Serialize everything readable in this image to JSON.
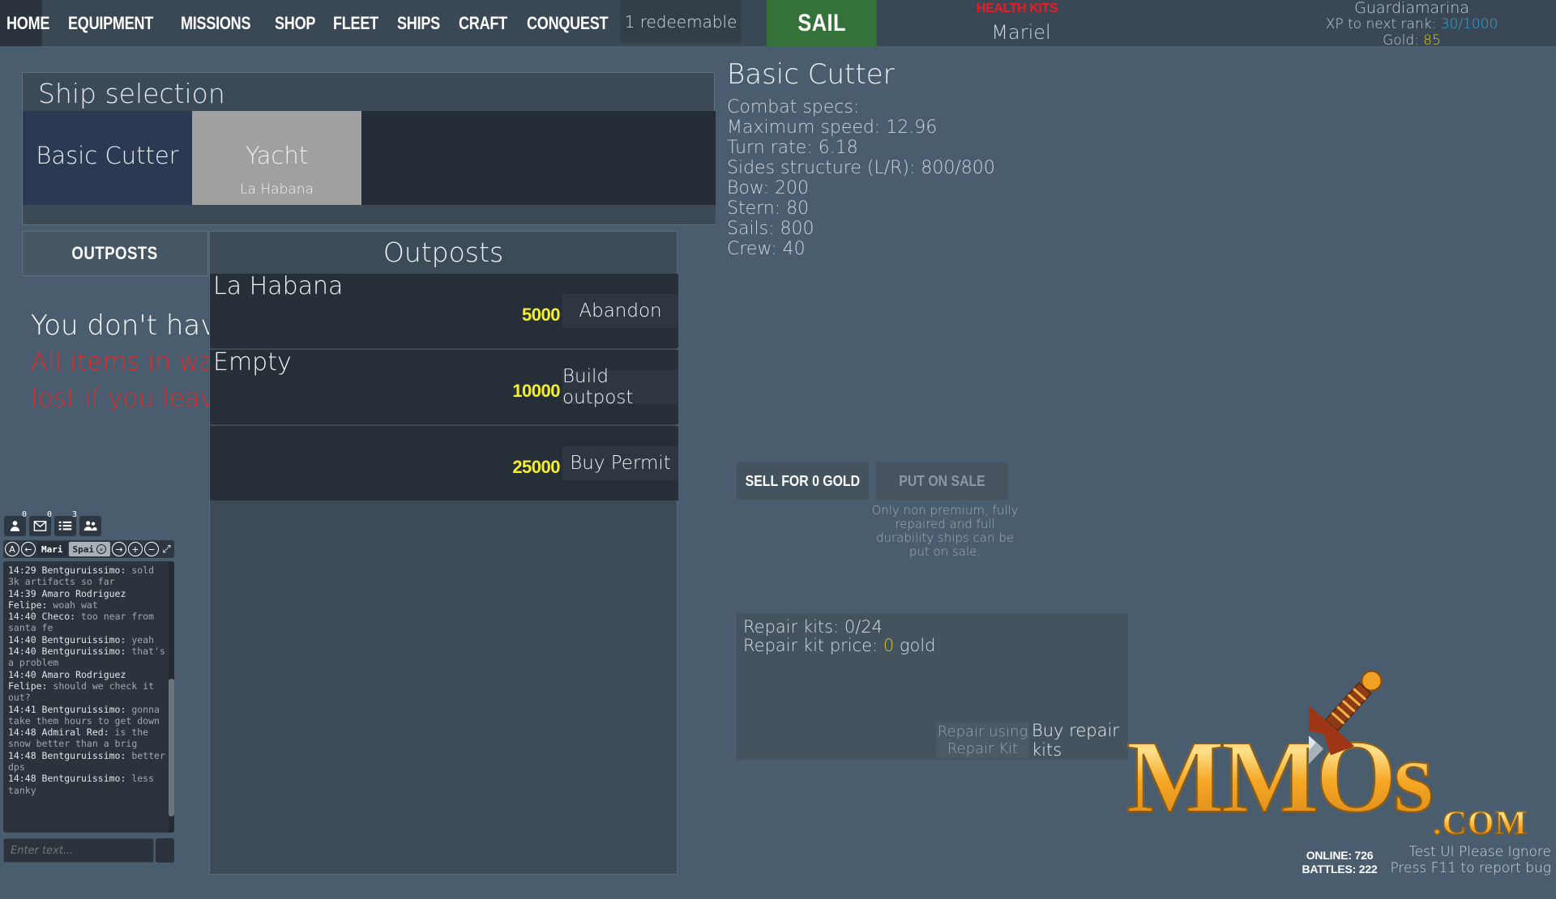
{
  "topbar": {
    "nav_items": [
      "HOME",
      "EQUIPMENT",
      "MISSIONS",
      "SHOP",
      "FLEET",
      "SHIPS",
      "CRAFT",
      "CONQUEST"
    ],
    "redeemable_label": "1 redeemable",
    "sail_label": "SAIL",
    "health_kits_label": "HEALTH KITS",
    "player_name": "Mariel",
    "rank_name": "Guardiamarina",
    "xp_label": "XP to next rank: ",
    "xp_value": "30/1000",
    "gold_label": "Gold: ",
    "gold_value": "85"
  },
  "ship_selection": {
    "title": "Ship selection",
    "ships": [
      {
        "name": "Basic Cutter",
        "location": ""
      },
      {
        "name": "Yacht",
        "location": "La Habana"
      }
    ]
  },
  "left_tabs": {
    "outposts_label": "OUTPOSTS"
  },
  "warning": {
    "line1": "You don't have",
    "line2": "All items in wareh",
    "line3": "lost if you leave"
  },
  "outposts_panel": {
    "title": "Outposts",
    "rows": [
      {
        "label": "La Habana",
        "price": "5000",
        "action": "Abandon"
      },
      {
        "label": "Empty",
        "price": "10000",
        "action": "Build outpost"
      },
      {
        "label": "",
        "price": "25000",
        "action": "Buy Permit"
      }
    ]
  },
  "ship_detail": {
    "title": "Basic Cutter",
    "specs_heading": "Combat specs:",
    "specs": [
      "Maximum speed: 12.96",
      "Turn rate: 6.18",
      "Sides structure (L/R): 800/800",
      "Bow: 200",
      "Stern: 80",
      "Sails: 800",
      "Crew: 40"
    ],
    "sell_label": "SELL FOR 0 GOLD",
    "put_on_sale_label": "PUT ON SALE",
    "sale_note": "Only non premium, fully repaired and full durability ships can be put on sale."
  },
  "repair": {
    "kits_line": "Repair kits: 0/24",
    "price_label": "Repair kit price: ",
    "price_value": "0",
    "price_suffix": " gold",
    "repair_using_label": "Repair using Repair Kit",
    "buy_kits_label": "Buy repair kits"
  },
  "chat": {
    "icon_badges": [
      "0",
      "0",
      "3",
      ""
    ],
    "icons": [
      "person-icon",
      "envelope-icon",
      "list-icon",
      "group-icon"
    ],
    "tabs": [
      {
        "label": "Mari",
        "active": false
      },
      {
        "label": "Spai",
        "active": true
      }
    ],
    "input_placeholder": "Enter text...",
    "messages": [
      {
        "head": "14:29 Bentguruissimo:",
        "body": " sold 3k artifacts so far"
      },
      {
        "head": "14:39 Amaro Rodriguez Felipe:",
        "body": " woah wat"
      },
      {
        "head": "14:40 Checo:",
        "body": " too near from santa fe"
      },
      {
        "head": "14:40 Bentguruissimo:",
        "body": " yeah"
      },
      {
        "head": "14:40 Bentguruissimo:",
        "body": " that's a problem"
      },
      {
        "head": "14:40 Amaro Rodriguez Felipe:",
        "body": " should we check it out?"
      },
      {
        "head": "14:41 Bentguruissimo:",
        "body": " gonna take them hours to get down"
      },
      {
        "head": "14:48 Admiral Red:",
        "body": " is the snow better than a brig"
      },
      {
        "head": "14:48 Bentguruissimo:",
        "body": " better dps"
      },
      {
        "head": "14:48 Bentguruissimo:",
        "body": " less tanky"
      }
    ]
  },
  "watermark": {
    "text": "MMOs",
    "suffix": ".COM"
  },
  "footer": {
    "online": "ONLINE: 726",
    "battles": "BATTLES: 222",
    "notice_line1": "Test UI Please Ignore",
    "notice_line2": "Press F11 to report bug"
  },
  "colors": {
    "background": "#4a5d6e",
    "topbar": "#3a4754",
    "sail_green": "#35723a",
    "gold_yellow": "#f4ef2f",
    "xp_blue": "#3ba3d8",
    "warning_red": "#e02b2b",
    "health_red": "#ee1b24"
  }
}
